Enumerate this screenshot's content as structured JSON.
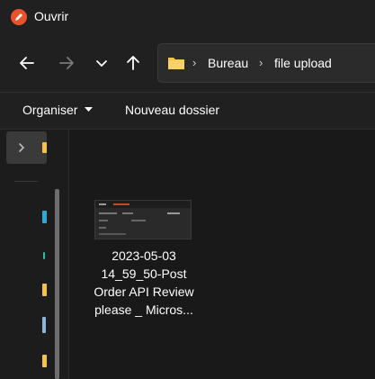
{
  "window": {
    "title": "Ouvrir"
  },
  "address_bar": {
    "crumbs": [
      "Bureau",
      "file upload"
    ]
  },
  "toolbar": {
    "organize_label": "Organiser",
    "new_folder_label": "Nouveau dossier"
  },
  "files": [
    {
      "name_lines": [
        "2023-05-03",
        "14_59_50-Post",
        "Order API Review",
        "please _ Micros..."
      ]
    }
  ],
  "colors": {
    "background": "#191919",
    "chrome": "#202020",
    "app_icon": "#e8532b",
    "folder": "#f2c14e"
  }
}
